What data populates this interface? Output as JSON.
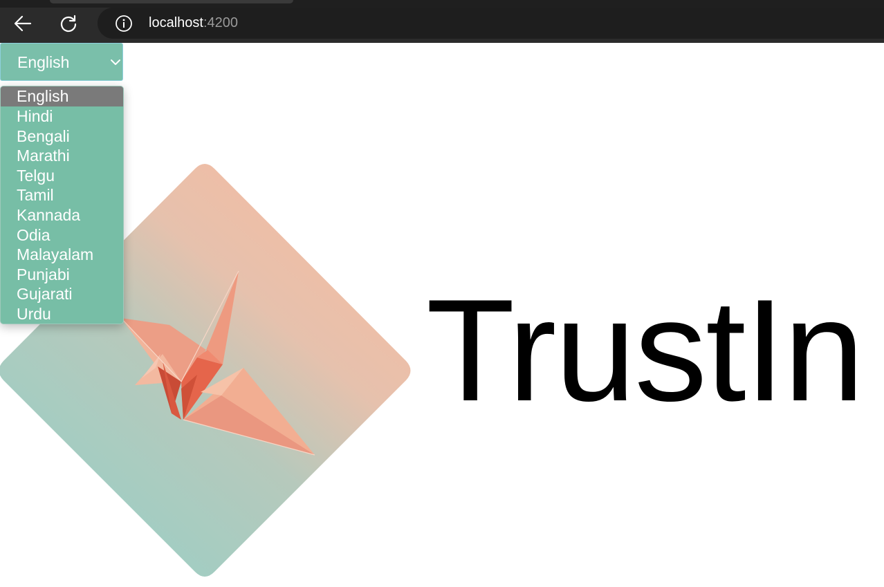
{
  "browser": {
    "url_host": "localhost",
    "url_port": ":4200"
  },
  "language_select": {
    "selected": "English",
    "options": [
      "English",
      "Hindi",
      "Bengali",
      "Marathi",
      "Telgu",
      "Tamil",
      "Kannada",
      "Odia",
      "Malayalam",
      "Punjabi",
      "Gujarati",
      "Urdu"
    ],
    "highlighted_option": "English"
  },
  "brand": {
    "name": "TrustIn"
  },
  "colors": {
    "select_bg": "#7abfaa",
    "dropdown_bg": "#77bea6",
    "highlight_bg": "#7a7a7a",
    "logo_gradient_top": "#f4bca2",
    "logo_gradient_bottom": "#a3cdc2",
    "crane": "#e9967f"
  },
  "icons": {
    "back": "arrow-left-icon",
    "reload": "reload-icon",
    "info": "info-icon",
    "chevron": "chevron-down-icon"
  }
}
